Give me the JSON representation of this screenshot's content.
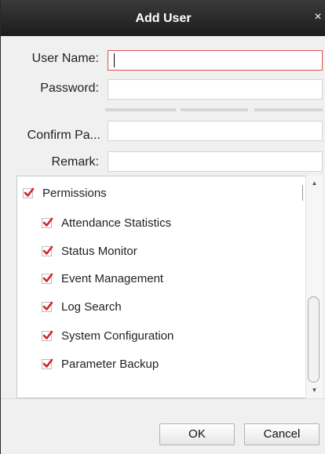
{
  "dialog": {
    "title": "Add User",
    "close_glyph": "×"
  },
  "form": {
    "username_label": "User Name:",
    "username_value": "",
    "password_label": "Password:",
    "password_value": "",
    "confirm_label": "Confirm Pa...",
    "confirm_value": "",
    "remark_label": "Remark:",
    "remark_value": ""
  },
  "permissions": {
    "group_label": "Permissions",
    "group_checked": true,
    "items": [
      {
        "label": "Attendance Statistics",
        "checked": true
      },
      {
        "label": "Status Monitor",
        "checked": true
      },
      {
        "label": "Event Management",
        "checked": true
      },
      {
        "label": "Log Search",
        "checked": true
      },
      {
        "label": "System Configuration",
        "checked": true
      },
      {
        "label": "Parameter Backup",
        "checked": true
      }
    ]
  },
  "buttons": {
    "ok": "OK",
    "cancel": "Cancel"
  },
  "colors": {
    "titlebar": "#1c1c1c",
    "checkmark": "#d2232a",
    "focus_border": "#d9534f",
    "dialog_bg": "#f0f0f0"
  },
  "icons": {
    "close": "close-icon",
    "check": "checkmark-icon",
    "scroll_up": "scroll-up-arrow-icon",
    "scroll_down": "scroll-down-arrow-icon"
  }
}
